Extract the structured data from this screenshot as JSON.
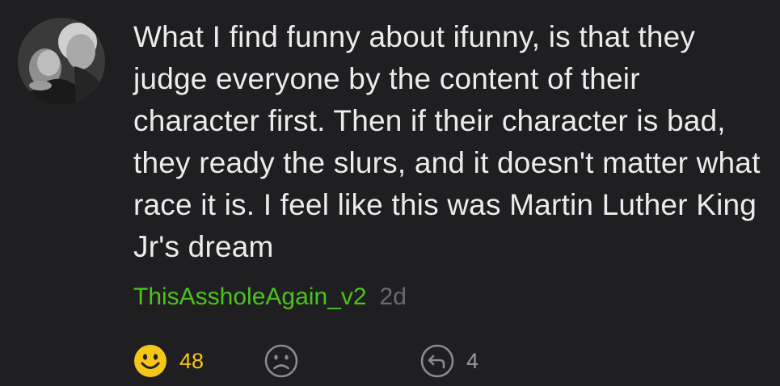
{
  "comment": {
    "text": "What I find funny about ifunny, is that they judge everyone by the content of their character first. Then if their character is bad, they ready the slurs, and it doesn't matter what race it is. I feel like this was Martin Luther King Jr's dream",
    "username": "ThisAssholeAgain_v2",
    "timestamp": "2d"
  },
  "actions": {
    "like_count": "48",
    "reply_count": "4"
  },
  "icons": {
    "like": "smiley-face-icon",
    "dislike": "frown-face-icon",
    "reply": "reply-arrow-icon"
  },
  "colors": {
    "background": "#1f1f21",
    "text": "#ececec",
    "username": "#4cc21d",
    "timestamp": "#6a6a6c",
    "like": "#f5c518",
    "inactive_icon": "#8a8a8c"
  }
}
